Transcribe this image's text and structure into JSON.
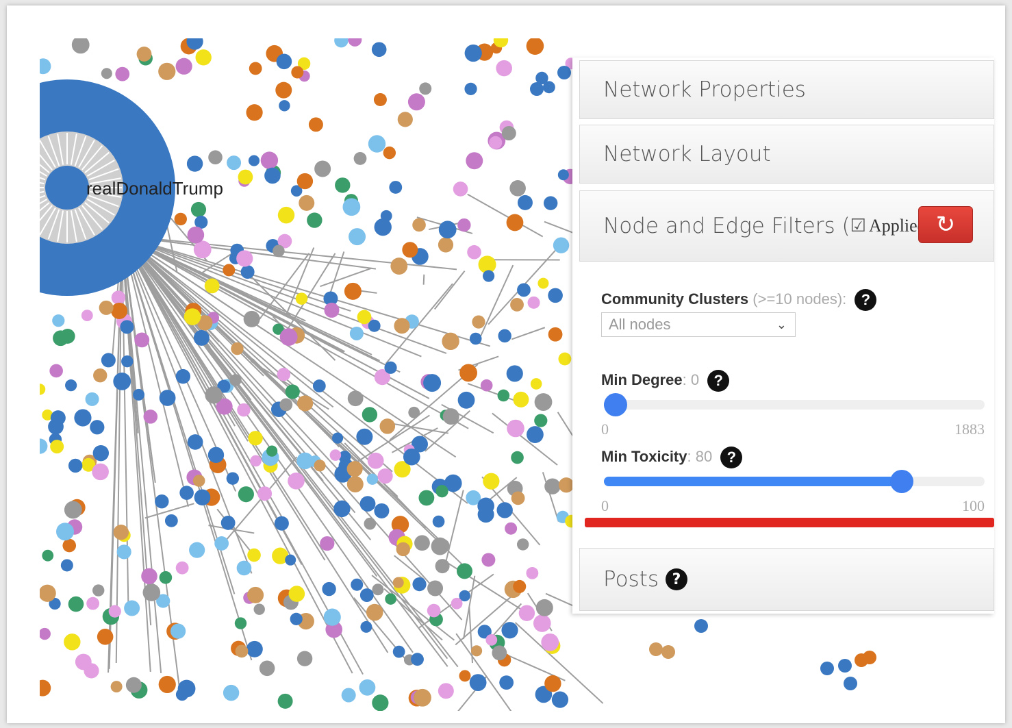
{
  "graph": {
    "hub_label": "realDonaldTrump",
    "colors": {
      "blue": "#3a78c2",
      "pink": "#e29ee0",
      "purple": "#c47ac7",
      "yellow": "#f2e21a",
      "green": "#3b9e6a",
      "orange": "#d9731e",
      "tan": "#cf9a5c",
      "gray": "#999999",
      "light_blue": "#7cc0ec",
      "edge": "#9e9e9e"
    }
  },
  "panel": {
    "network_properties": "Network Properties",
    "network_layout": "Network Layout",
    "filters_title": "Node and Edge Filters (",
    "filters_applied": "Applied)",
    "reset_icon": "refresh-icon",
    "community_label": "Community Clusters",
    "community_hint": " (>=10 nodes):",
    "community_selected": "All nodes",
    "min_degree_label": "Min Degree",
    "min_degree_value": ": 0",
    "degree_min": "0",
    "degree_max": "1883",
    "degree_level": 0,
    "min_toxicity_label": "Min Toxicity",
    "min_toxicity_value": ": 80",
    "toxicity_min": "0",
    "toxicity_max": "100",
    "toxicity_level": 0.8,
    "posts": "Posts",
    "help": "?"
  }
}
